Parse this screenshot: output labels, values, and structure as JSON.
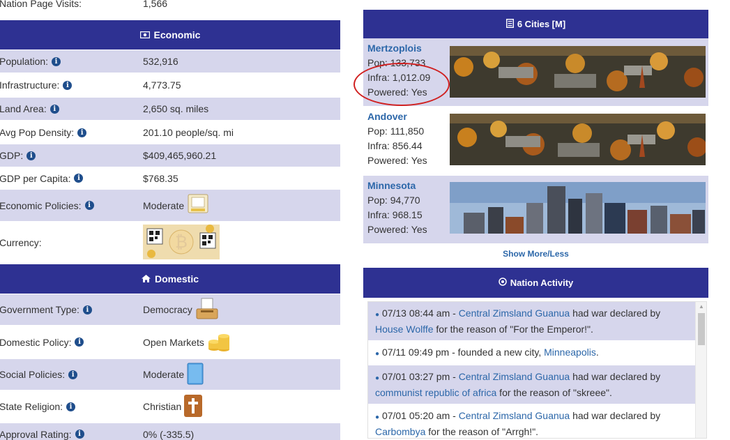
{
  "left": {
    "top_partial": {
      "label": "Nation Page Visits:",
      "value": "1,566"
    },
    "economic_header": {
      "icon": "money-icon",
      "title": "Economic"
    },
    "economic_rows": [
      {
        "label": "Population:",
        "value": "532,916",
        "info": true
      },
      {
        "label": "Infrastructure:",
        "value": "4,773.75",
        "info": true
      },
      {
        "label": "Land Area:",
        "value": "2,650 sq. miles",
        "info": true
      },
      {
        "label": "Avg Pop Density:",
        "value": "201.10 people/sq. mi",
        "info": true
      },
      {
        "label": "GDP:",
        "value": "$409,465,960.21",
        "info": true
      },
      {
        "label": "GDP per Capita:",
        "value": "$768.35",
        "info": true
      },
      {
        "label": "Economic Policies:",
        "value": "Moderate",
        "info": true
      },
      {
        "label": "Currency:",
        "value": "",
        "info": false
      }
    ],
    "domestic_header": {
      "icon": "home-icon",
      "title": "Domestic"
    },
    "domestic_rows": [
      {
        "label": "Government Type:",
        "value": "Democracy",
        "info": true
      },
      {
        "label": "Domestic Policy:",
        "value": "Open Markets",
        "info": true
      },
      {
        "label": "Social Policies:",
        "value": "Moderate",
        "info": true
      },
      {
        "label": "State Religion:",
        "value": "Christian",
        "info": true
      },
      {
        "label": "Approval Rating:",
        "value": "0% (-335.5)",
        "info": true
      }
    ]
  },
  "cities": {
    "header": {
      "icon": "city-list-icon",
      "title": "6 Cities [M]"
    },
    "items": [
      {
        "name": "Mertzoplois",
        "pop": "Pop: 133,733",
        "infra": "Infra: 1,012.09",
        "powered": "Powered: Yes"
      },
      {
        "name": "Andover",
        "pop": "Pop: 111,850",
        "infra": "Infra: 856.44",
        "powered": "Powered: Yes"
      },
      {
        "name": "Minnesota",
        "pop": "Pop: 94,770",
        "infra": "Infra: 968.15",
        "powered": "Powered: Yes"
      }
    ],
    "show_more": "Show More/Less"
  },
  "activity": {
    "header": {
      "icon": "target-icon",
      "title": "Nation Activity"
    },
    "items": [
      {
        "time": "07/13 08:44 am - ",
        "actor": "Central Zimsland Guanua",
        "middle": " had war declared by ",
        "target": "House Wolffe",
        "tail": " for the reason of \"For the Emperor!\"."
      },
      {
        "time": "07/11 09:49 pm - founded a new city, ",
        "actor": "",
        "middle": "",
        "target": "Minneapolis",
        "tail": "."
      },
      {
        "time": "07/01 03:27 pm - ",
        "actor": "Central Zimsland Guanua",
        "middle": " had war declared by ",
        "target": "communist republic of africa",
        "tail": " for the reason of \"skreee\"."
      },
      {
        "time": "07/01 05:20 am - ",
        "actor": "Central Zimsland Guanua",
        "middle": " had war declared by ",
        "target": "Carbombya",
        "tail": " for the reason of \"Arrgh!\"."
      }
    ]
  },
  "colors": {
    "header_bg": "#2e3192",
    "row_shade": "#d6d6ec",
    "link": "#2c67a9",
    "annotation": "#d02020"
  }
}
